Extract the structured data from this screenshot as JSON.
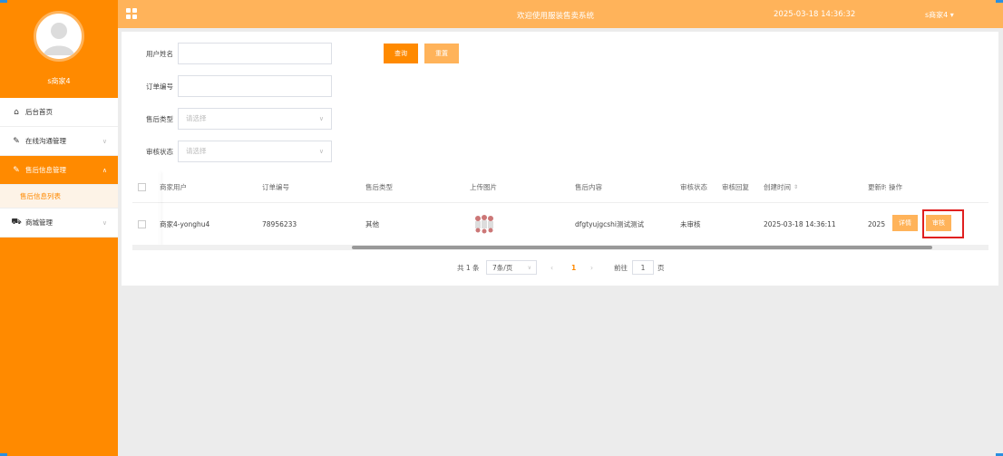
{
  "sidebar": {
    "username": "s商家4",
    "menu": [
      {
        "label": "后台首页",
        "icon": "home-icon",
        "glyph": "⌂"
      },
      {
        "label": "在线沟通管理",
        "icon": "edit-icon",
        "glyph": "✎"
      },
      {
        "label": "售后信息管理",
        "icon": "edit-icon",
        "glyph": "✎"
      },
      {
        "label": "售后信息列表"
      },
      {
        "label": "商城管理",
        "icon": "cart-icon",
        "glyph": "⛟"
      }
    ]
  },
  "topbar": {
    "title": "欢迎使用服装售卖系统",
    "datetime": "2025-03-18 14:36:32",
    "user": "s商家4 ▾"
  },
  "filters": {
    "username_label": "用户姓名",
    "order_label": "订单编号",
    "type_label": "售后类型",
    "type_placeholder": "请选择",
    "status_label": "审核状态",
    "status_placeholder": "请选择",
    "query_button": "查询",
    "reset_button": "重置"
  },
  "table": {
    "headers": [
      "商家用户",
      "订单编号",
      "售后类型",
      "上传图片",
      "售后内容",
      "审核状态",
      "审核回复",
      "创建时间",
      "更新时间",
      "操作"
    ],
    "rows": [
      {
        "merchant_user": "商家4-yonghu4",
        "order_no": "78956233",
        "type": "其他",
        "content": "dfgtyujgcshi测试测试",
        "status": "未审核",
        "reply": "",
        "created": "2025-03-18 14:36:11",
        "updated": "2025",
        "detail_button": "详情",
        "audit_button": "审核"
      }
    ]
  },
  "pagination": {
    "total": "共 1 条",
    "page_size": "7条/页",
    "current": "1",
    "jump_label": "前往",
    "jump_value": "1",
    "page_suffix": "页"
  },
  "colors": {
    "primary": "#ff8a00",
    "light": "#ffb35a",
    "highlight_border": "#e02020"
  }
}
